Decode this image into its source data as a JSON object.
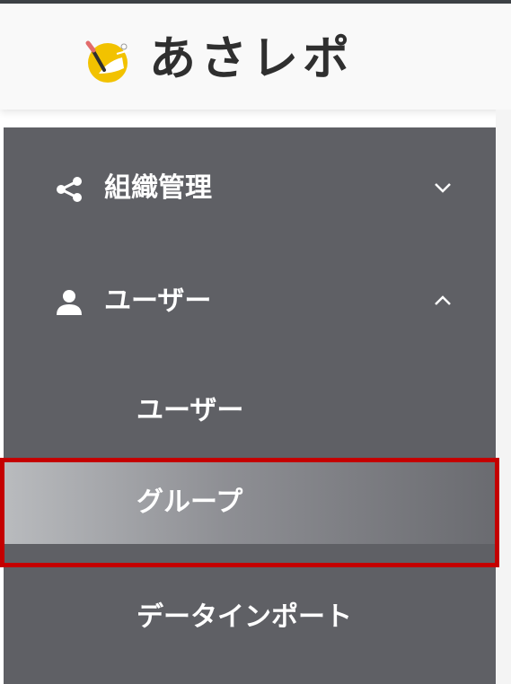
{
  "app": {
    "logo_name": "あさレポ"
  },
  "sidebar": {
    "items": [
      {
        "label": "組織管理",
        "icon": "share-icon",
        "chevron": "chevron-down-icon"
      },
      {
        "label": "ユーザー",
        "icon": "user-icon",
        "chevron": "chevron-up-icon",
        "children": [
          {
            "label": "ユーザー"
          },
          {
            "label": "グループ",
            "active": true
          },
          {
            "label": "データインポート"
          }
        ]
      }
    ]
  },
  "colors": {
    "sidebar_bg": "#5f6065",
    "highlight_border": "#c40000"
  }
}
